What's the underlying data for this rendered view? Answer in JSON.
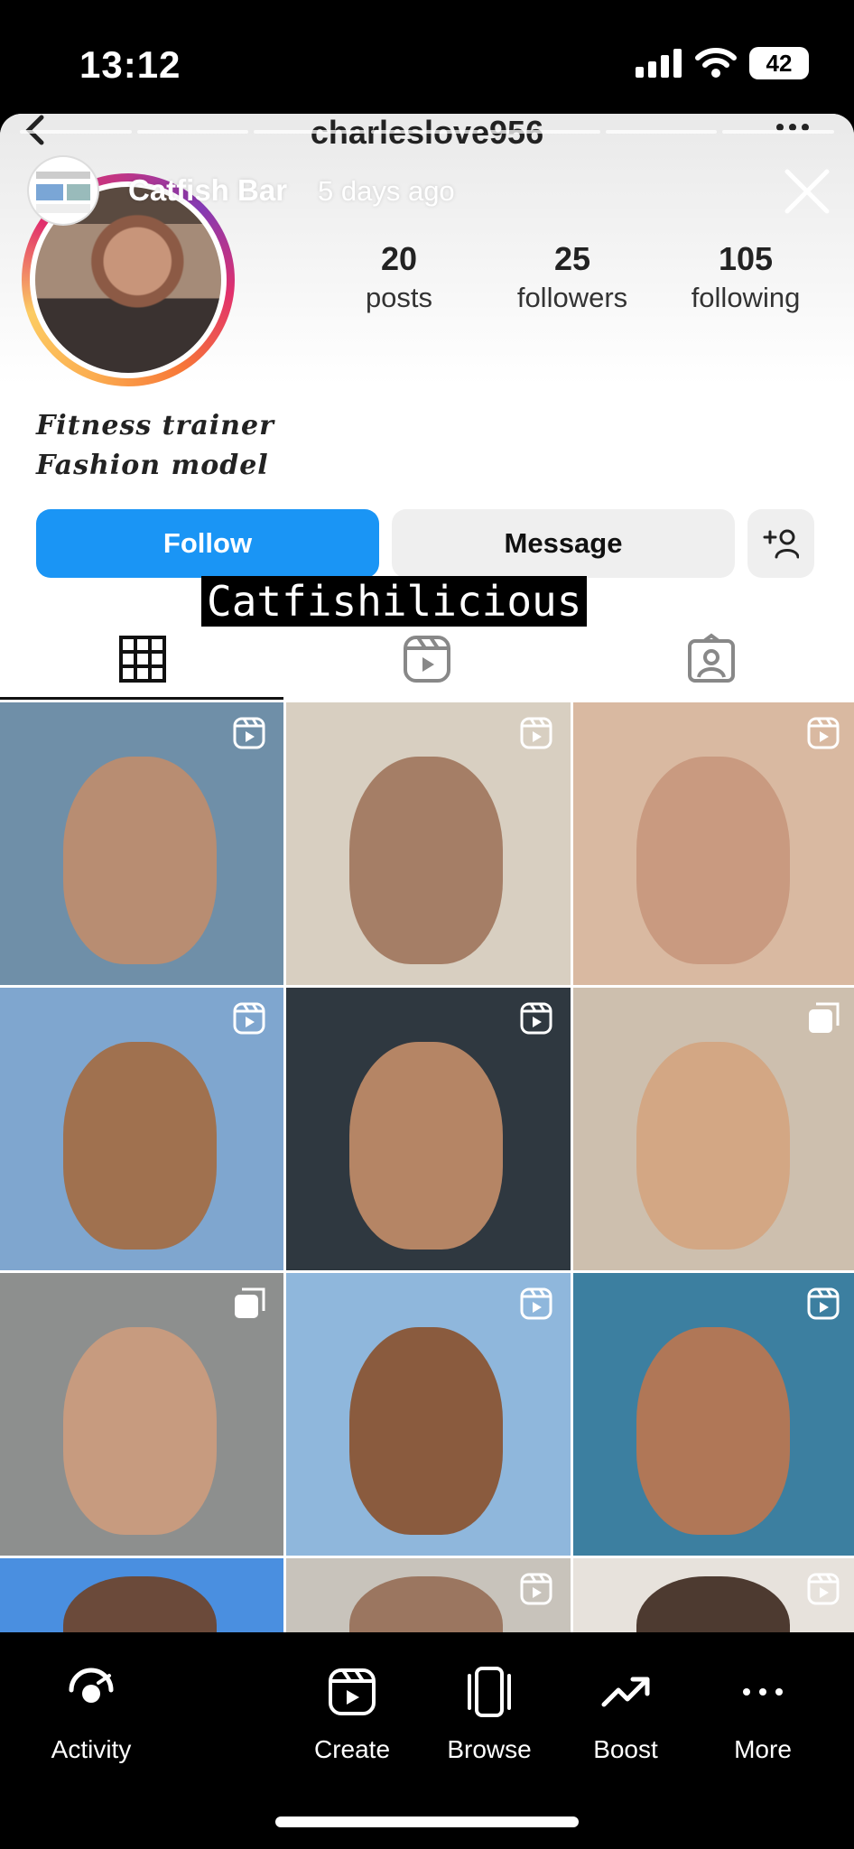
{
  "status_bar": {
    "time": "13:12",
    "battery": "42"
  },
  "profile": {
    "username": "charleslove956",
    "posts_count": "20",
    "posts_label": "posts",
    "followers_count": "25",
    "followers_label": "followers",
    "following_count": "105",
    "following_label": "following",
    "bio_line1": "Fitness trainer",
    "bio_line2": "Fashion model"
  },
  "story": {
    "title": "Catfish Bar",
    "time_ago": "5 days ago",
    "caption": "Catfishilicious",
    "segments": 7
  },
  "actions": {
    "follow_label": "Follow",
    "message_label": "Message"
  },
  "tabs": [
    "grid-icon",
    "reels-icon",
    "tagged-icon"
  ],
  "grid": {
    "cells": [
      {
        "bg": "#6f8fa8",
        "face": "#b88d72",
        "icon": "reel-icon"
      },
      {
        "bg": "#d8cfc1",
        "face": "#a57e66",
        "icon": "reel-icon"
      },
      {
        "bg": "#d9b9a1",
        "face": "#c99a80",
        "icon": "reel-icon"
      },
      {
        "bg": "#7fa6cf",
        "face": "#a0714f",
        "icon": "reel-icon"
      },
      {
        "bg": "#2f3840",
        "face": "#b58565",
        "icon": "reel-icon"
      },
      {
        "bg": "#cdbfae",
        "face": "#d3a784",
        "icon": "carousel-icon"
      },
      {
        "bg": "#8d8f8e",
        "face": "#c79b7f",
        "icon": "carousel-icon"
      },
      {
        "bg": "#8fb7dc",
        "face": "#8a5b3e",
        "icon": "reel-icon"
      },
      {
        "bg": "#3c7fa0",
        "face": "#b07757",
        "icon": "reel-icon"
      },
      {
        "bg": "#4a8fe0",
        "face": "#6b4a3a",
        "icon": ""
      },
      {
        "bg": "#c8c3bb",
        "face": "#9b7660",
        "icon": "reel-icon"
      },
      {
        "bg": "#e7e2dc",
        "face": "#4d3a30",
        "icon": "reel-icon"
      }
    ]
  },
  "bottom_bar": {
    "activity": "Activity",
    "create": "Create",
    "browse": "Browse",
    "boost": "Boost",
    "more": "More"
  },
  "colors": {
    "follow_blue": "#1a95f5",
    "ring_gradient": "instagram"
  }
}
